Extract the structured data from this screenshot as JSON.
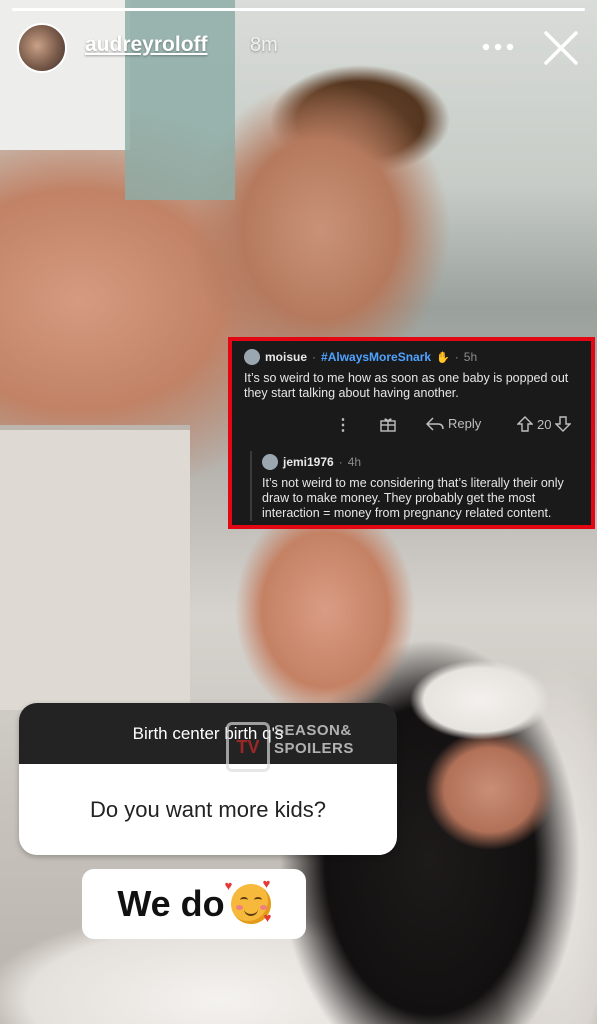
{
  "story": {
    "username": "audreyroloff",
    "time_ago": "8m",
    "progress_fraction": 1.0
  },
  "reddit_post": {
    "comment": {
      "user": "moisue",
      "flair": "#AlwaysMoreSnark",
      "separator": "·",
      "time": "5h",
      "text": "It’s so weird to me how as soon as one baby is popped out they start talking about having another.",
      "reply_label": "Reply",
      "vote_count": "20"
    },
    "reply": {
      "user": "jemi1976",
      "separator": "·",
      "time": "4h",
      "text": "It’s not weird to me considering that’s literally their only draw to make money. They probably get the most interaction = money from pregnancy related content."
    }
  },
  "question_sticker": {
    "header": "Birth center birth q's",
    "question": "Do you want more kids?"
  },
  "answer_text": "We do",
  "watermark": {
    "logo": "TV",
    "line1": "SEASON&",
    "line2": "SPOILERS"
  },
  "icons": {
    "more": "more-horizontal-icon",
    "close": "close-icon",
    "award": "award-icon",
    "reply": "reply-icon",
    "upvote": "upvote-icon",
    "downvote": "downvote-icon",
    "emoji": "smiling-face-with-hearts-icon"
  },
  "colors": {
    "highlight_border": "#e30613",
    "flair": "#4fa3ff",
    "reddit_bg": "#1a1a1b"
  }
}
